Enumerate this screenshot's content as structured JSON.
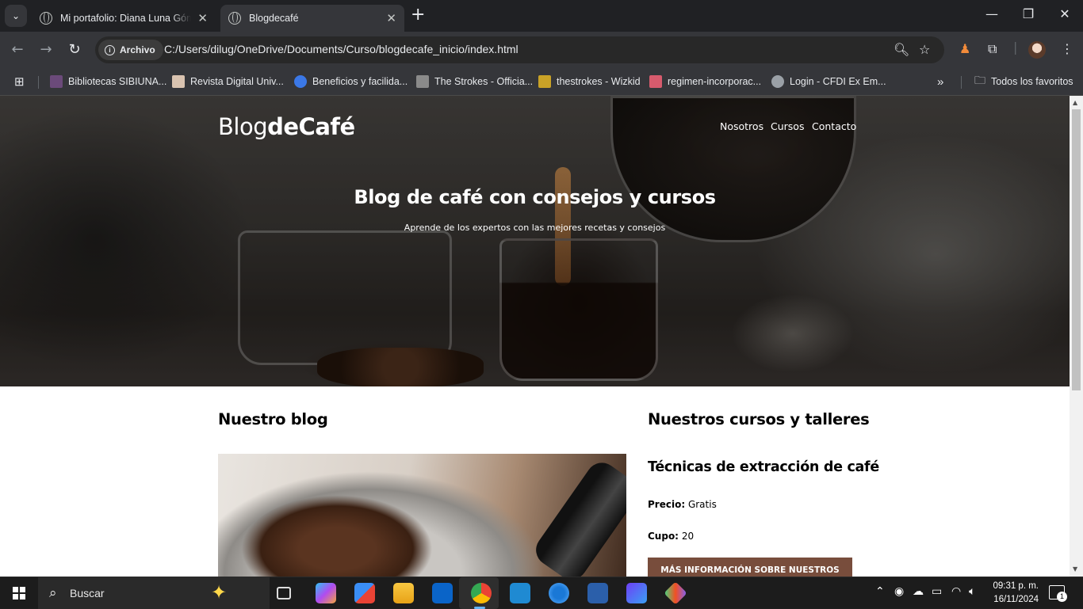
{
  "browser": {
    "tabs": [
      {
        "title": "Mi portafolio: Diana Luna Gómez",
        "close": "✕",
        "active": false
      },
      {
        "title": "Blogdecafé",
        "close": "✕",
        "active": true
      }
    ],
    "new_tab": "+",
    "window_controls": {
      "minimize": "—",
      "restore": "❐",
      "close": "✕"
    },
    "address": {
      "chip_label": "Archivo",
      "url": "C:/Users/dilug/OneDrive/Documents/Curso/blogdecafe_inicio/index.html"
    },
    "bookmarks": [
      {
        "label": "Bibliotecas SIBIUNA...",
        "color": "#6b4a7a"
      },
      {
        "label": "Revista Digital Univ...",
        "color": "#d9c3b0"
      },
      {
        "label": "Beneficios y facilida...",
        "color": "#3b78e7"
      },
      {
        "label": "The Strokes - Officia...",
        "color": "#8a8a8a"
      },
      {
        "label": "thestrokes - Wizkid",
        "color": "#c9a227"
      },
      {
        "label": "regimen-incorporac...",
        "color": "#d75b6d"
      },
      {
        "label": "Login - CFDI Ex Em...",
        "color": "#9aa0a6"
      }
    ],
    "bookmarks_overflow": "»",
    "all_bookmarks": "Todos los favoritos"
  },
  "page": {
    "logo_regular": "Blog",
    "logo_bold": "deCafé",
    "nav": [
      "Nosotros",
      "Cursos",
      "Contacto"
    ],
    "hero_title": "Blog de café con consejos y cursos",
    "hero_subtitle": "Aprende de los expertos con las mejores recetas y consejos",
    "blog_heading": "Nuestro blog",
    "courses_heading": "Nuestros cursos y talleres",
    "course": {
      "title": "Técnicas de extracción de café",
      "price_label": "Precio:",
      "price_value": "Gratis",
      "seats_label": "Cupo:",
      "seats_value": "20",
      "button": "Más información sobre nuestros"
    },
    "colors": {
      "button_bg": "#784d3c"
    }
  },
  "taskbar": {
    "search_placeholder": "Buscar",
    "time": "09:31 p. m.",
    "date": "16/11/2024",
    "notifications": "1"
  }
}
